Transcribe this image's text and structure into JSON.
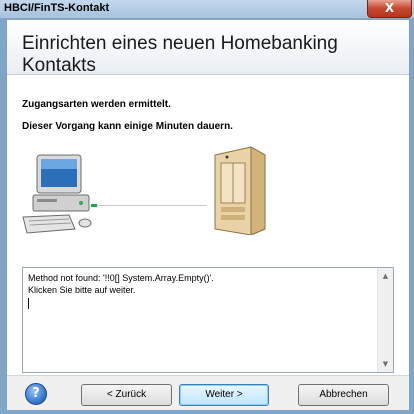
{
  "window": {
    "title": "HBCI/FinTS-Kontakt",
    "close_label": "X"
  },
  "header": {
    "title": "Einrichten eines neuen Homebanking Kontakts"
  },
  "body": {
    "line1": "Zugangsarten werden ermittelt.",
    "line2": "Dieser Vorgang kann einige Minuten dauern."
  },
  "log": {
    "line1": "Method not found: '!!0[] System.Array.Empty()'.",
    "line2": "Klicken Sie bitte auf weiter."
  },
  "buttons": {
    "help": "?",
    "back": "< Zurück",
    "next": "Weiter >",
    "cancel": "Abbrechen"
  }
}
